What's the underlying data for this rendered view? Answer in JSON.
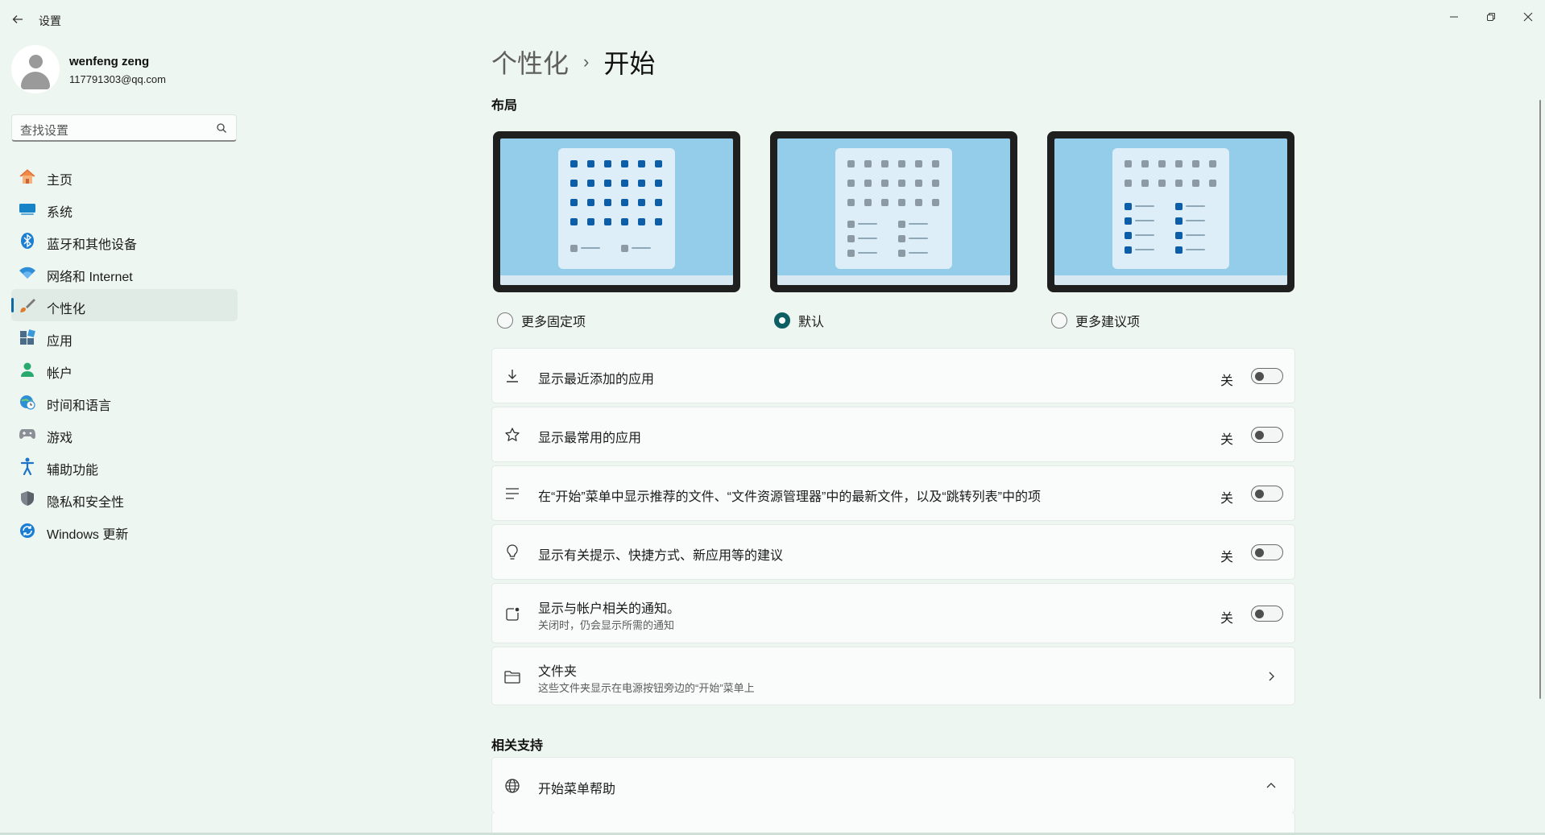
{
  "window": {
    "title": "设置",
    "back_icon": "back-arrow-icon",
    "controls": [
      "minimize-icon",
      "restore-icon",
      "close-icon"
    ]
  },
  "user": {
    "name": "wenfeng zeng",
    "email": "117791303@qq.com"
  },
  "search": {
    "placeholder": "查找设置"
  },
  "sidebar": {
    "items": [
      {
        "label": "主页",
        "icon": "home-icon",
        "active": false
      },
      {
        "label": "系统",
        "icon": "system-display-icon",
        "active": false
      },
      {
        "label": "蓝牙和其他设备",
        "icon": "bluetooth-icon",
        "active": false
      },
      {
        "label": "网络和 Internet",
        "icon": "wifi-icon",
        "active": false
      },
      {
        "label": "个性化",
        "icon": "paintbrush-icon",
        "active": true
      },
      {
        "label": "应用",
        "icon": "apps-icon",
        "active": false
      },
      {
        "label": "帐户",
        "icon": "account-icon",
        "active": false
      },
      {
        "label": "时间和语言",
        "icon": "globe-clock-icon",
        "active": false
      },
      {
        "label": "游戏",
        "icon": "gamepad-icon",
        "active": false
      },
      {
        "label": "辅助功能",
        "icon": "accessibility-icon",
        "active": false
      },
      {
        "label": "隐私和安全性",
        "icon": "shield-icon",
        "active": false
      },
      {
        "label": "Windows 更新",
        "icon": "update-icon",
        "active": false
      }
    ]
  },
  "breadcrumb": {
    "parent": "个性化",
    "separator": "›",
    "current": "开始"
  },
  "layout_section": {
    "title": "布局",
    "options": [
      {
        "label": "更多固定项",
        "selected": false
      },
      {
        "label": "默认",
        "selected": true
      },
      {
        "label": "更多建议项",
        "selected": false
      }
    ]
  },
  "settings": [
    {
      "icon": "download-icon",
      "title": "显示最近添加的应用",
      "subtitle": "",
      "state": "关",
      "on": false
    },
    {
      "icon": "star-icon",
      "title": "显示最常用的应用",
      "subtitle": "",
      "state": "关",
      "on": false
    },
    {
      "icon": "list-icon",
      "title": "在“开始”菜单中显示推荐的文件、“文件资源管理器”中的最新文件，以及“跳转列表”中的项",
      "subtitle": "",
      "state": "关",
      "on": false
    },
    {
      "icon": "lightbulb-icon",
      "title": "显示有关提示、快捷方式、新应用等的建议",
      "subtitle": "",
      "state": "关",
      "on": false
    },
    {
      "icon": "notification-badge-icon",
      "title": "显示与帐户相关的通知。",
      "subtitle": "关闭时，仍会显示所需的通知",
      "state": "关",
      "on": false
    }
  ],
  "folders_row": {
    "icon": "folder-icon",
    "title": "文件夹",
    "subtitle": "这些文件夹显示在电源按钮旁边的“开始”菜单上"
  },
  "support": {
    "title": "相关支持",
    "item": {
      "icon": "globe-icon",
      "title": "开始菜单帮助",
      "expanded": true
    }
  },
  "colors": {
    "background": "#eef6f1",
    "accent": "#0e5f63",
    "nav_indicator": "#0b6aa4",
    "card_bg": "#f9fcfa"
  }
}
